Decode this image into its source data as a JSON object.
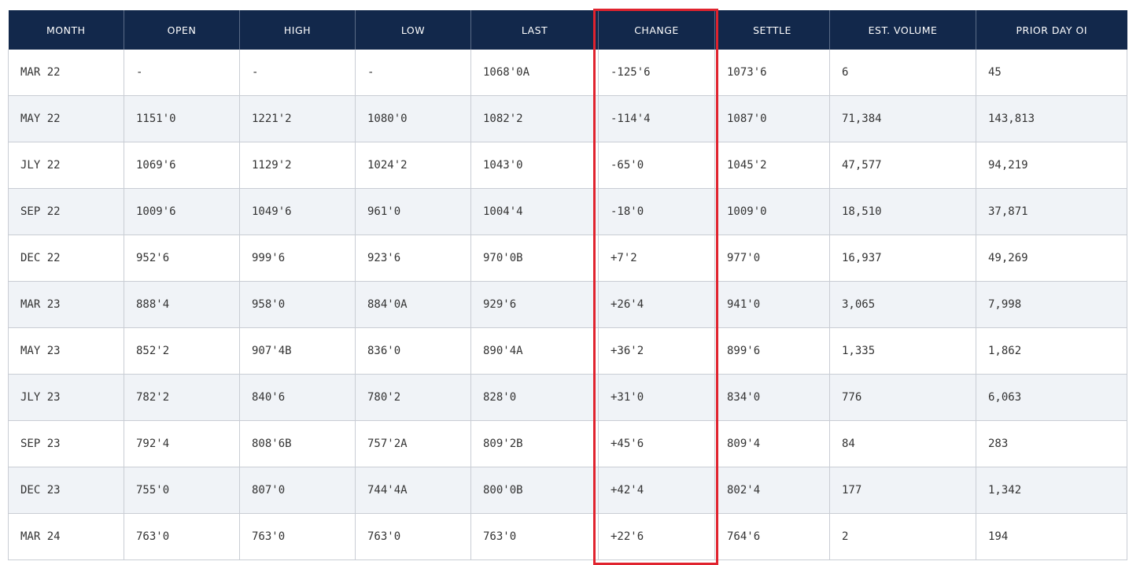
{
  "table": {
    "headers": [
      "MONTH",
      "OPEN",
      "HIGH",
      "LOW",
      "LAST",
      "CHANGE",
      "SETTLE",
      "EST. VOLUME",
      "PRIOR DAY OI"
    ],
    "rows": [
      [
        "MAR 22",
        "-",
        "-",
        "-",
        "1068'0A",
        "-125'6",
        "1073'6",
        "6",
        "45"
      ],
      [
        "MAY 22",
        "1151'0",
        "1221'2",
        "1080'0",
        "1082'2",
        "-114'4",
        "1087'0",
        "71,384",
        "143,813"
      ],
      [
        "JLY 22",
        "1069'6",
        "1129'2",
        "1024'2",
        "1043'0",
        "-65'0",
        "1045'2",
        "47,577",
        "94,219"
      ],
      [
        "SEP 22",
        "1009'6",
        "1049'6",
        "961'0",
        "1004'4",
        "-18'0",
        "1009'0",
        "18,510",
        "37,871"
      ],
      [
        "DEC 22",
        "952'6",
        "999'6",
        "923'6",
        "970'0B",
        "+7'2",
        "977'0",
        "16,937",
        "49,269"
      ],
      [
        "MAR 23",
        "888'4",
        "958'0",
        "884'0A",
        "929'6",
        "+26'4",
        "941'0",
        "3,065",
        "7,998"
      ],
      [
        "MAY 23",
        "852'2",
        "907'4B",
        "836'0",
        "890'4A",
        "+36'2",
        "899'6",
        "1,335",
        "1,862"
      ],
      [
        "JLY 23",
        "782'2",
        "840'6",
        "780'2",
        "828'0",
        "+31'0",
        "834'0",
        "776",
        "6,063"
      ],
      [
        "SEP 23",
        "792'4",
        "808'6B",
        "757'2A",
        "809'2B",
        "+45'6",
        "809'4",
        "84",
        "283"
      ],
      [
        "DEC 23",
        "755'0",
        "807'0",
        "744'4A",
        "800'0B",
        "+42'4",
        "802'4",
        "177",
        "1,342"
      ],
      [
        "MAR 24",
        "763'0",
        "763'0",
        "763'0",
        "763'0",
        "+22'6",
        "764'6",
        "2",
        "194"
      ]
    ]
  },
  "colors": {
    "header_bg": "#12284b",
    "header_text": "#ffffff",
    "row_alt_bg": "#f0f3f7",
    "highlight": "#e0232e"
  }
}
